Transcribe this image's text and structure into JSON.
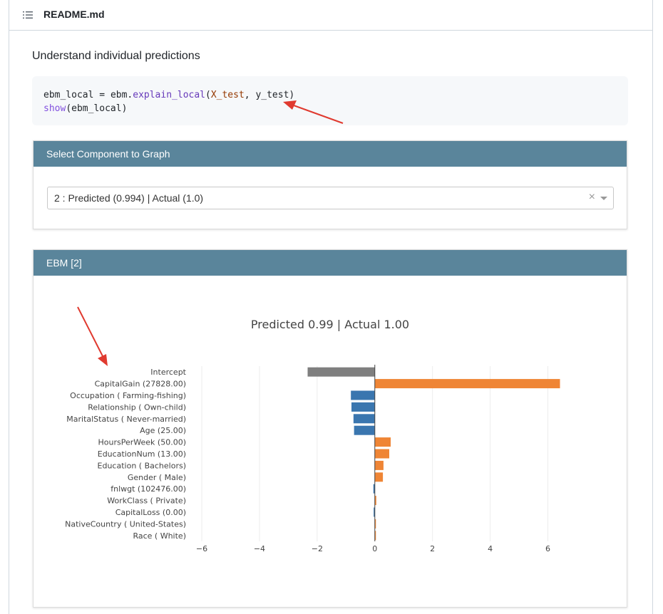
{
  "file": {
    "name": "README.md",
    "toc_icon": "list-icon"
  },
  "readme": {
    "intro": "Understand individual predictions",
    "code": {
      "line1": {
        "var": "ebm_local",
        "op": " = ",
        "obj": "ebm.",
        "fn": "explain_local",
        "open": "(",
        "arg1": "X_test",
        "sep": ", ",
        "arg2": "y_test",
        "close": ")"
      },
      "line2": {
        "fn": "show",
        "open": "(",
        "arg": "ebm_local",
        "close": ")"
      }
    }
  },
  "selector_panel": {
    "title": "Select Component to Graph",
    "selected": "2 : Predicted (0.994) | Actual (1.0)",
    "clear_glyph": "×"
  },
  "chart_panel": {
    "title": "EBM [2]"
  },
  "colors": {
    "header_bar": "#5a859b",
    "negative": "#3a76af",
    "positive": "#ef8535",
    "intercept": "#7f7f7f",
    "annotation_arrow": "#e03a2f"
  },
  "chart_data": {
    "type": "bar",
    "orientation": "horizontal",
    "title": "Predicted 0.99 | Actual 1.00",
    "categories": [
      "Intercept",
      "CapitalGain (27828.00)",
      "Occupation ( Farming-fishing)",
      "Relationship ( Own-child)",
      "MaritalStatus ( Never-married)",
      "Age (25.00)",
      "HoursPerWeek (50.00)",
      "EducationNum (13.00)",
      "Education ( Bachelors)",
      "Gender ( Male)",
      "fnlwgt (102476.00)",
      "WorkClass ( Private)",
      "CapitalLoss (0.00)",
      "NativeCountry ( United-States)",
      "Race ( White)"
    ],
    "values": [
      -2.33,
      6.42,
      -0.83,
      -0.81,
      -0.74,
      -0.72,
      0.55,
      0.5,
      0.3,
      0.28,
      -0.05,
      0.05,
      -0.04,
      0.03,
      0.03
    ],
    "bar_colors": [
      "intercept",
      "positive",
      "negative",
      "negative",
      "negative",
      "negative",
      "positive",
      "positive",
      "positive",
      "positive",
      "negative",
      "positive",
      "negative",
      "positive",
      "positive"
    ],
    "xlim": [
      -6.1,
      7.1
    ],
    "xticks": [
      -6,
      -4,
      -2,
      0,
      2,
      4,
      6
    ],
    "xtick_labels": [
      "−6",
      "−4",
      "−2",
      "0",
      "2",
      "4",
      "6"
    ],
    "grid": true,
    "legend": "none"
  }
}
